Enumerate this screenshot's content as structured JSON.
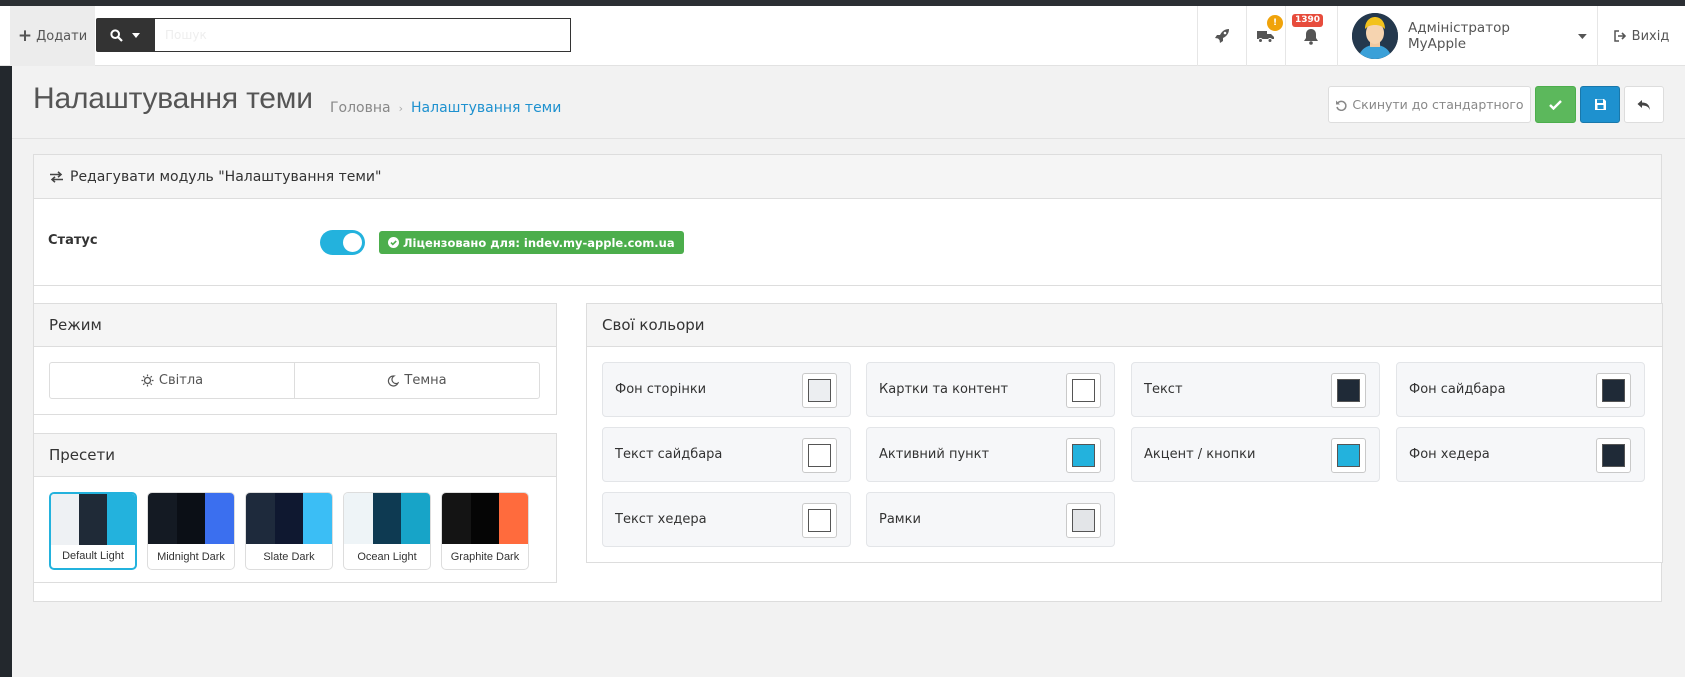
{
  "header": {
    "add_label": "Додати",
    "search_placeholder": "Пошук",
    "shipping_badge": "!",
    "notifications_count": "1390",
    "user_name": "Адміністратор MyApple",
    "logout_label": "Вихід"
  },
  "page": {
    "title": "Налаштування теми",
    "breadcrumb": [
      "Головна",
      "Налаштування теми"
    ]
  },
  "toolbar": {
    "reset_label": "Скинути до стандартного"
  },
  "module_panel": {
    "title": "Редагувати модуль \"Налаштування теми\"",
    "status_label": "Статус",
    "status_enabled": true,
    "license_text": "Ліцензовано для: indev.my-apple.com.ua"
  },
  "mode_panel": {
    "title": "Режим",
    "options": [
      "Світла",
      "Темна"
    ]
  },
  "presets_panel": {
    "title": "Пресети",
    "presets": [
      {
        "name": "Default Light",
        "colors": [
          "#eef1f4",
          "#1f2a37",
          "#23b2dd"
        ],
        "active": true
      },
      {
        "name": "Midnight Dark",
        "colors": [
          "#141a23",
          "#0b0f16",
          "#3b6fef"
        ],
        "active": false
      },
      {
        "name": "Slate Dark",
        "colors": [
          "#1e2a3c",
          "#0f1830",
          "#3bbef5"
        ],
        "active": false
      },
      {
        "name": "Ocean Light",
        "colors": [
          "#eef4f7",
          "#0e3a52",
          "#17a4c8"
        ],
        "active": false
      },
      {
        "name": "Graphite Dark",
        "colors": [
          "#141414",
          "#050505",
          "#ff6b3d"
        ],
        "active": false
      }
    ]
  },
  "colors_panel": {
    "title": "Свої кольори",
    "items": [
      {
        "label": "Фон сторінки",
        "color": "#eceef1"
      },
      {
        "label": "Картки та контент",
        "color": "#ffffff"
      },
      {
        "label": "Текст",
        "color": "#1f2a37"
      },
      {
        "label": "Фон сайдбара",
        "color": "#1f2a37"
      },
      {
        "label": "Текст сайдбара",
        "color": "#ffffff"
      },
      {
        "label": "Активний пункт",
        "color": "#23b2dd"
      },
      {
        "label": "Акцент / кнопки",
        "color": "#23b2dd"
      },
      {
        "label": "Фон хедера",
        "color": "#1f2a37"
      },
      {
        "label": "Текст хедера",
        "color": "#ffffff"
      },
      {
        "label": "Рамки",
        "color": "#e3e5e8"
      }
    ]
  },
  "theme": {
    "accent": "#23b2dd",
    "success": "#5cb85c",
    "primary": "#1e91cf",
    "danger": "#e74c3c",
    "warning": "#f0a30a"
  }
}
